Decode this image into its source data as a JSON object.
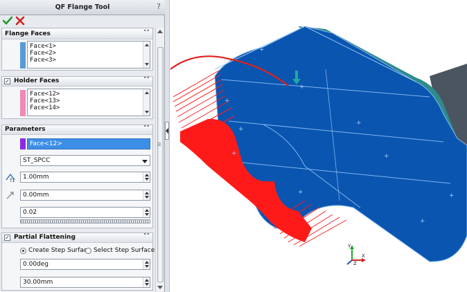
{
  "window": {
    "title": "QF Flange Tool",
    "help_label": "?"
  },
  "actions": {
    "ok": "ok-checkmark-icon",
    "cancel": "cancel-x-icon"
  },
  "flange_faces": {
    "title": "Flange Faces",
    "color": "#5b9bd5",
    "items": [
      "Face<1>",
      "Face<2>",
      "Face<3>"
    ]
  },
  "holder_faces": {
    "title": "Holder Faces",
    "checked": true,
    "color": "#f08ab6",
    "items": [
      "Face<12>",
      "Face<13>",
      "Face<14>"
    ]
  },
  "parameters": {
    "title": "Parameters",
    "selection_color": "#8a2be2",
    "selected_face": "Face<12>",
    "material": "ST_SPCC",
    "thickness": "1.00mm",
    "offset": "0.00mm",
    "factor": "0.02"
  },
  "partial_flattening": {
    "title": "Partial Flattening",
    "checked": true,
    "option_create": "Create Step Surface",
    "option_select": "Select Step Surface",
    "selected_option": "create",
    "angle": "0.00deg",
    "distance": "30.00mm"
  },
  "colors": {
    "model_body": "#0a55b0",
    "model_edge": "#7fb5f0",
    "flange_preview": "#ff1a1a",
    "teal_fillet": "#2e8b8b",
    "gray_part": "#4a5560"
  },
  "triad": {
    "x": "X",
    "y": "Y",
    "z": "Z"
  }
}
